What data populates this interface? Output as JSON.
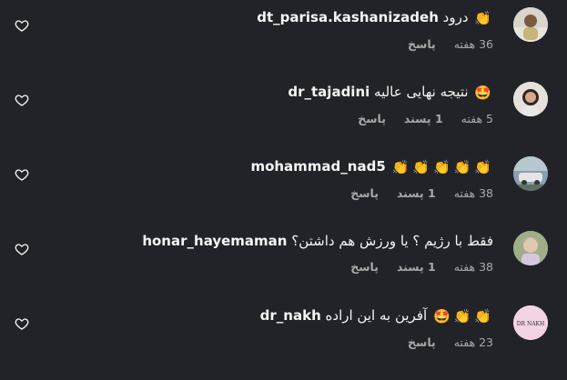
{
  "comments": [
    {
      "username": "dt_parisa.kashanizadeh",
      "text": "درود",
      "emojis": [
        "👏"
      ],
      "time": "36 هفته",
      "likes": "",
      "reply": "پاسخ",
      "avatar_color": "#c9b89a"
    },
    {
      "username": "dr_tajadini",
      "text": "نتیجه نهایی عالیه",
      "emojis": [
        "🤩"
      ],
      "time": "5 هفته",
      "likes": "1 پسند",
      "reply": "پاسخ",
      "avatar_color": "#d8d1c8"
    },
    {
      "username": "mohammad_nad5",
      "text": "",
      "emojis": [
        "👏",
        "👏",
        "👏",
        "👏",
        "👏"
      ],
      "time": "38 هفته",
      "likes": "1 پسند",
      "reply": "پاسخ",
      "avatar_color": "#6f7f8c"
    },
    {
      "username": "honar_hayemaman",
      "text": "فقط با رژیم ؟ یا ورزش هم داشتن؟",
      "emojis": [],
      "time": "38 هفته",
      "likes": "1 پسند",
      "reply": "پاسخ",
      "avatar_color": "#a7b38f"
    },
    {
      "username": "dr_nakh",
      "text": "آفرین به این اراده",
      "emojis": [
        "🤩",
        "👏",
        "👏"
      ],
      "time": "23 هفته",
      "likes": "",
      "reply": "پاسخ",
      "avatar_color": "#f3d3e4",
      "avatar_text": "DR NAKH"
    }
  ]
}
